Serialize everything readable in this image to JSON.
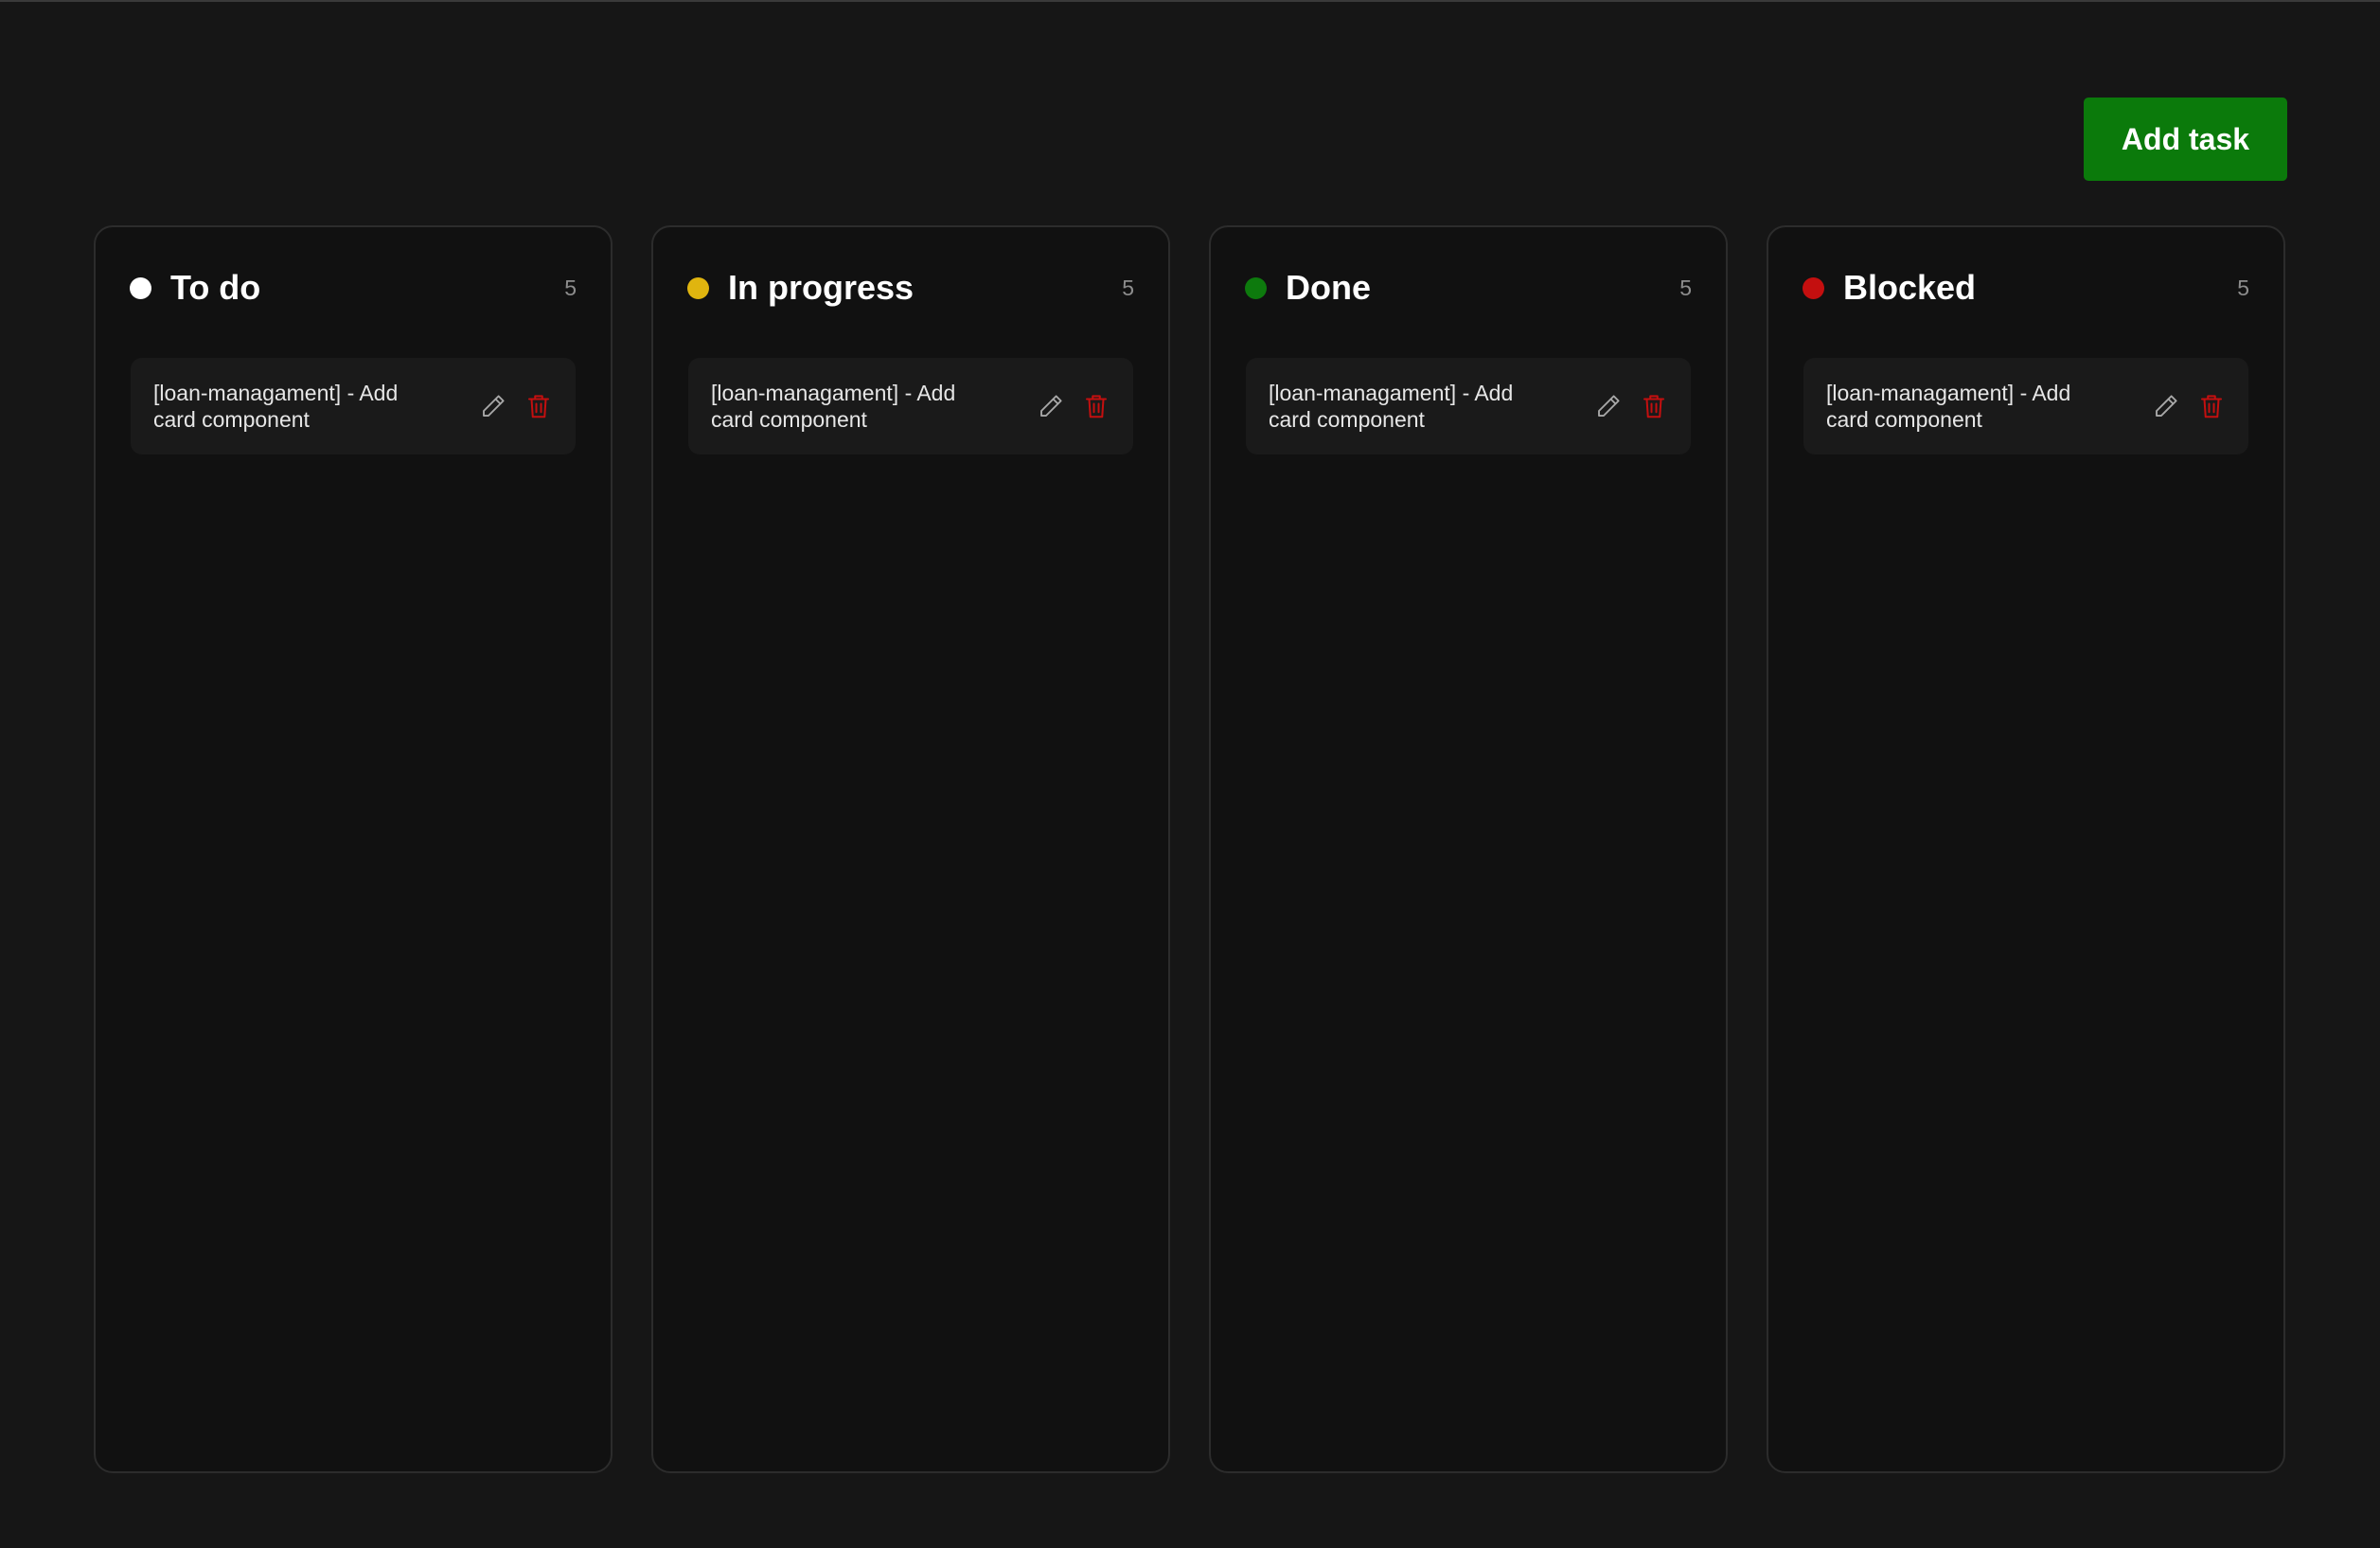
{
  "toolbar": {
    "add_task_label": "Add task"
  },
  "colors": {
    "background": "#161616",
    "column_background": "#111111",
    "card_background": "#1a1a1a",
    "accent_green_button": "#0b7a0b",
    "delete_red": "#c40f0f"
  },
  "columns": [
    {
      "title": "To do",
      "count": "5",
      "dot_color": "#ffffff",
      "cards": [
        {
          "title": "[loan-managament] - Add card component",
          "edit_icon": "pencil-icon",
          "delete_icon": "trash-icon"
        }
      ]
    },
    {
      "title": "In progress",
      "count": "5",
      "dot_color": "#e0b50f",
      "cards": [
        {
          "title": "[loan-managament] - Add card component",
          "edit_icon": "pencil-icon",
          "delete_icon": "trash-icon"
        }
      ]
    },
    {
      "title": "Done",
      "count": "5",
      "dot_color": "#0d7a0d",
      "cards": [
        {
          "title": "[loan-managament] - Add card component",
          "edit_icon": "pencil-icon",
          "delete_icon": "trash-icon"
        }
      ]
    },
    {
      "title": "Blocked",
      "count": "5",
      "dot_color": "#c40f0f",
      "cards": [
        {
          "title": "[loan-managament] - Add card component",
          "edit_icon": "pencil-icon",
          "delete_icon": "trash-icon"
        }
      ]
    }
  ]
}
